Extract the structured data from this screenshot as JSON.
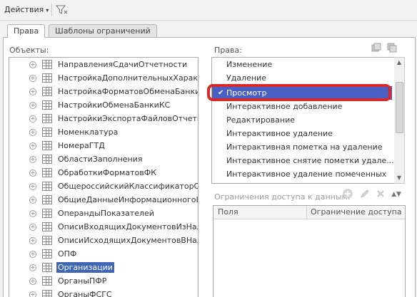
{
  "toolbar": {
    "actions_label": "Действия",
    "actions_arrow": "▾",
    "filter_icon": "filter-icon"
  },
  "tabs": [
    {
      "label": "Права",
      "active": true
    },
    {
      "label": "Шаблоны ограничений",
      "active": false
    }
  ],
  "objects": {
    "label": "Объекты:",
    "items": [
      {
        "label": "НаправленияСдачиОтчетности"
      },
      {
        "label": "НастройкаДополнительныхХарактери"
      },
      {
        "label": "НастройкаФорматовОбменаБанкиКС"
      },
      {
        "label": "НастройкиОбменаБанкиКС"
      },
      {
        "label": "НастройкиЭкспортаФайловОтчетност"
      },
      {
        "label": "Номенклатура"
      },
      {
        "label": "НомераГТД"
      },
      {
        "label": "ОбластиЗаполнения"
      },
      {
        "label": "ОбработкиФорматовФК"
      },
      {
        "label": "ОбщероссийскийКлассификаторОсно"
      },
      {
        "label": "ОбщиеДанныеИнформационногоЦент"
      },
      {
        "label": "ОперандыПоказателей"
      },
      {
        "label": "ОписиВходящихДокументовИзНалого"
      },
      {
        "label": "ОписиИсходящихДокументовВНалого"
      },
      {
        "label": "ОПФ"
      },
      {
        "label": "Организации",
        "selected": true
      },
      {
        "label": "ОрганыПФР"
      },
      {
        "label": "ОрганыФСГС"
      }
    ]
  },
  "rights": {
    "label": "Права:",
    "items": [
      {
        "label": "Изменение"
      },
      {
        "label": "Удаление"
      },
      {
        "label": "Просмотр",
        "selected": true
      },
      {
        "label": "Интерактивное добавление"
      },
      {
        "label": "Редактирование"
      },
      {
        "label": "Интерактивное удаление"
      },
      {
        "label": "Интерактивная пометка на удаление"
      },
      {
        "label": "Интерактивное снятие пометки удале..."
      },
      {
        "label": "Интерактивное удаление помеченных"
      }
    ],
    "selected_check": "✔"
  },
  "limits": {
    "label": "Ограничения доступа к данным:",
    "columns": [
      "Поля",
      "Ограничение доступа"
    ]
  },
  "colors": {
    "selection_blue": "#4a5fc4",
    "highlight_red": "#d42a2a"
  }
}
